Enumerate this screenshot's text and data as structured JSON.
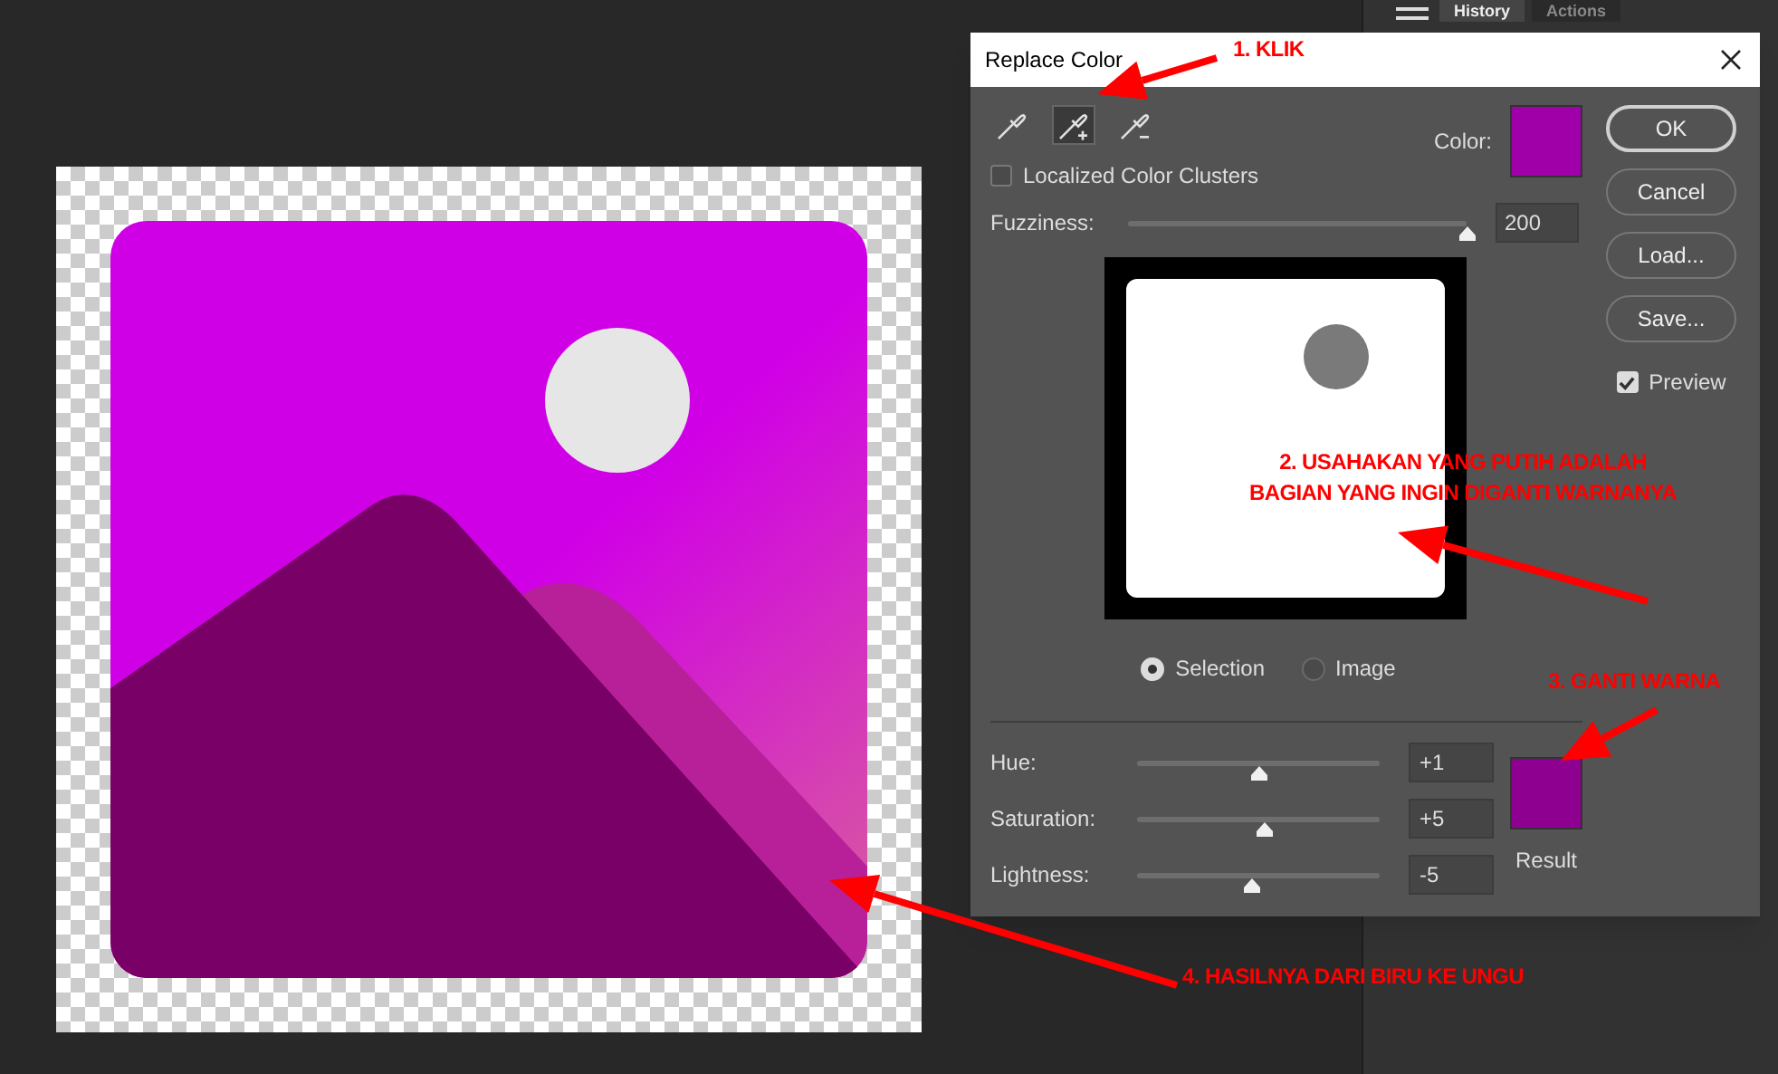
{
  "panel": {
    "tabs": [
      {
        "label": "History",
        "selected": true
      },
      {
        "label": "Actions",
        "selected": false
      }
    ]
  },
  "dialog": {
    "title": "Replace Color",
    "eyedroppers": [
      {
        "kind": "sample",
        "selected": false
      },
      {
        "kind": "add",
        "selected": true
      },
      {
        "kind": "subtract",
        "selected": false
      }
    ],
    "localized_color_clusters": {
      "label": "Localized Color Clusters",
      "checked": false
    },
    "color": {
      "label": "Color:",
      "color": "#a000a8"
    },
    "fuzziness": {
      "label": "Fuzziness:",
      "level": 1,
      "value": "200"
    },
    "view_options": [
      {
        "label": "Selection",
        "selected": true
      },
      {
        "label": "Image",
        "selected": false
      }
    ],
    "adjustments": [
      {
        "label": "Hue:",
        "level": 0.5,
        "value": "+1"
      },
      {
        "label": "Saturation:",
        "level": 0.52,
        "value": "+5"
      },
      {
        "label": "Lightness:",
        "level": 0.47,
        "value": "-5"
      }
    ],
    "result": {
      "label": "Result",
      "color": "#8e0090"
    },
    "buttons": [
      "OK",
      "Cancel",
      "Load...",
      "Save..."
    ],
    "preview": {
      "label": "Preview",
      "checked": true
    }
  },
  "annotations": [
    {
      "lines": [
        "1. KLIK"
      ]
    },
    {
      "lines": [
        "2. USAHAKAN YANG PUTIH ADALAH",
        "BAGIAN YANG INGIN DIGANTI WARNANYA"
      ]
    },
    {
      "lines": [
        "3. GANTI WARNA"
      ]
    },
    {
      "lines": [
        "4. HASILNYA DARI BIRU KE UNGU"
      ]
    }
  ]
}
